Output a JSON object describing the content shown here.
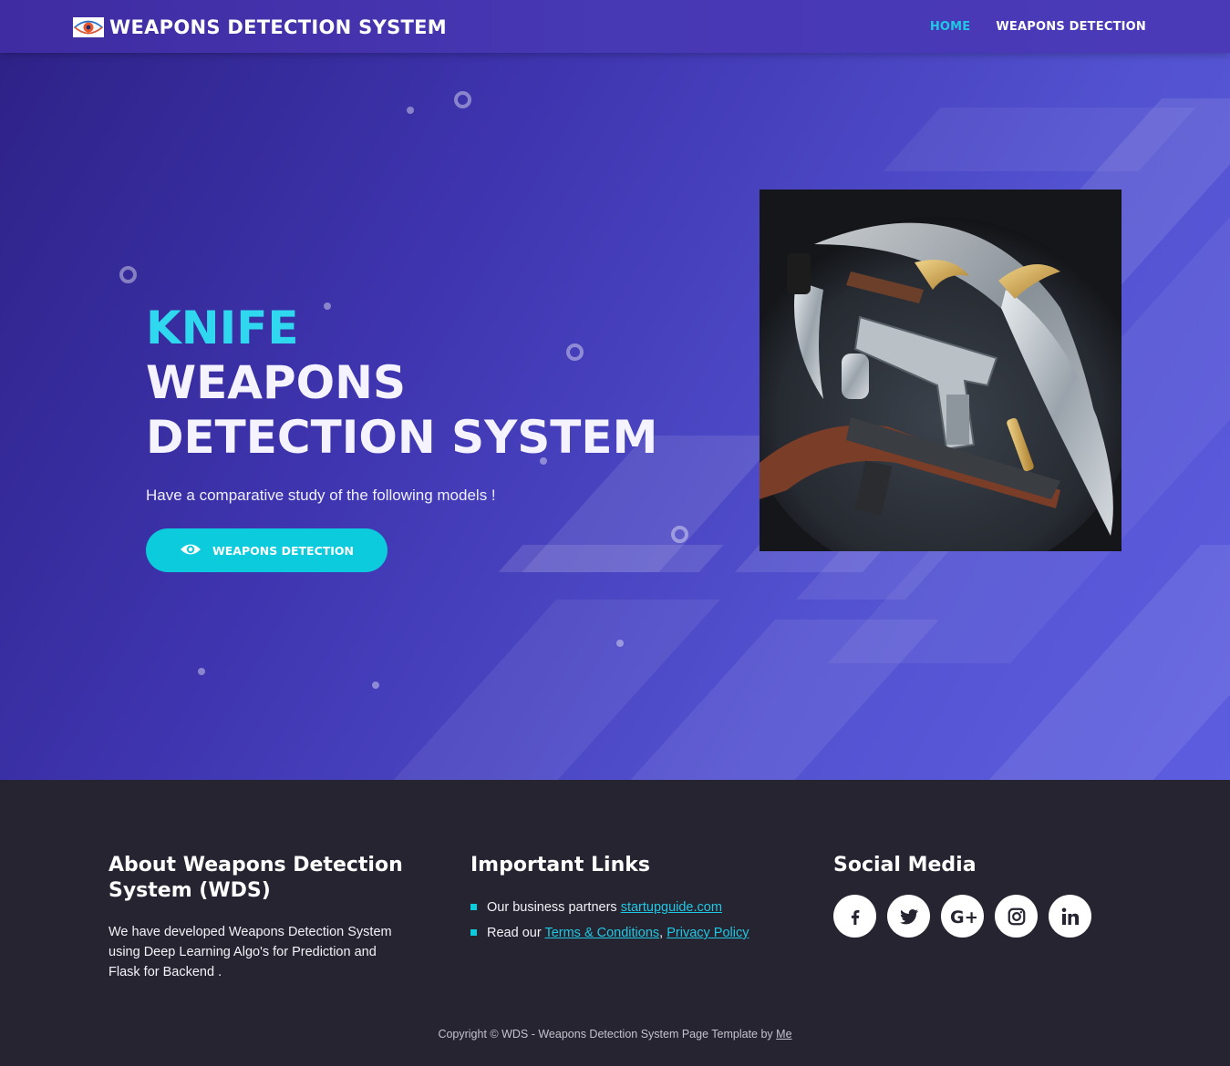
{
  "nav": {
    "brand": "WEAPONS DETECTION SYSTEM",
    "links": [
      "HOME",
      "WEAPONS DETECTION"
    ],
    "active_color": "#1fc8e3"
  },
  "hero": {
    "title_accent": "KNIFE",
    "title_line1": "WEAPONS",
    "title_line2": "DETECTION SYSTEM",
    "subtitle": "Have a comparative study of the following models !",
    "button_label": "WEAPONS DETECTION",
    "button_icon": "eye-icon",
    "image_icon": "weapons-photo",
    "accent_color": "#2fd8ee",
    "button_color": "#0ccbdc"
  },
  "footer": {
    "about": {
      "heading": "About Weapons Detection System (WDS)",
      "text": "We have developed Weapons Detection System using Deep Learning Algo's for Prediction and Flask for Backend ."
    },
    "links": {
      "heading": "Important Links",
      "item1_prefix": "Our business partners",
      "item1_link": "startupguide.com",
      "item2_prefix": "Read our",
      "item2_link1": "Terms & Conditions",
      "item2_sep": ",",
      "item2_link2": "Privacy Policy"
    },
    "social": {
      "heading": "Social Media",
      "icons": [
        "facebook-icon",
        "twitter-icon",
        "google-plus-icon",
        "instagram-icon",
        "linkedin-icon"
      ]
    },
    "copyright_prefix": "Copyright © WDS - Weapons Detection System Page Template by",
    "copyright_link": "Me"
  }
}
